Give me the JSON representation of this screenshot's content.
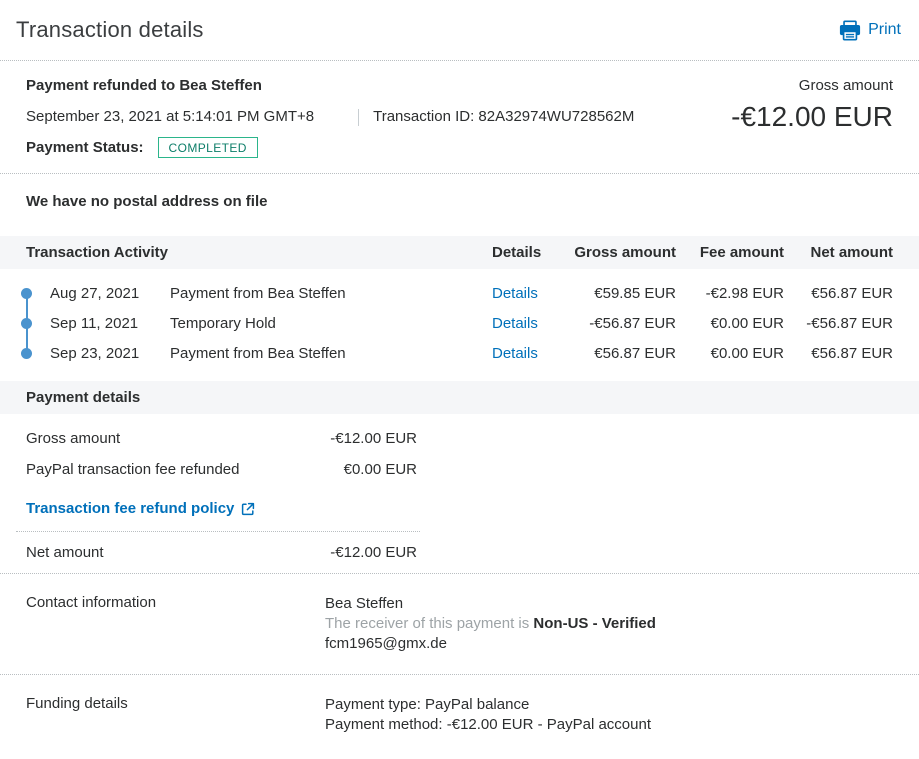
{
  "page": {
    "title": "Transaction details",
    "print_label": "Print"
  },
  "summary": {
    "heading": "Payment refunded to Bea Steffen",
    "date": "September 23, 2021 at 5:14:01 PM GMT+8",
    "transaction_id": "Transaction ID: 82A32974WU728562M",
    "payment_status_label": "Payment Status:",
    "payment_status": "COMPLETED",
    "gross_amount_label": "Gross amount",
    "gross_amount_value": "-€12.00 EUR"
  },
  "postal_note": "We have no postal address on file",
  "activity": {
    "title": "Transaction Activity",
    "columns": {
      "details": "Details",
      "gross": "Gross amount",
      "fee": "Fee amount",
      "net": "Net amount"
    },
    "rows": [
      {
        "date": "Aug 27, 2021",
        "description": "Payment from Bea Steffen",
        "details_label": "Details",
        "gross": "€59.85 EUR",
        "fee": "-€2.98 EUR",
        "net": "€56.87 EUR"
      },
      {
        "date": "Sep 11, 2021",
        "description": "Temporary Hold",
        "details_label": "Details",
        "gross": "-€56.87 EUR",
        "fee": "€0.00 EUR",
        "net": "-€56.87 EUR"
      },
      {
        "date": "Sep 23, 2021",
        "description": "Payment from Bea Steffen",
        "details_label": "Details",
        "gross": "€56.87 EUR",
        "fee": "€0.00 EUR",
        "net": "€56.87 EUR"
      }
    ]
  },
  "payment_details": {
    "title": "Payment details",
    "rows": [
      {
        "label": "Gross amount",
        "value": "-€12.00 EUR"
      },
      {
        "label": "PayPal transaction fee refunded",
        "value": "€0.00 EUR"
      }
    ],
    "policy_link_label": "Transaction fee refund policy",
    "net_label": "Net amount",
    "net_value": "-€12.00 EUR"
  },
  "contact": {
    "label": "Contact information",
    "name": "Bea Steffen",
    "receiver_prefix": "The receiver of this payment is ",
    "receiver_status": "Non-US - Verified",
    "email": "fcm1965@gmx.de"
  },
  "funding": {
    "label": "Funding details",
    "payment_type": "Payment type: PayPal balance",
    "payment_method": "Payment method: -€12.00 EUR - PayPal account"
  },
  "colors": {
    "link_blue": "#0070ba",
    "text_dark": "#2c2e2f",
    "status_border": "#2bb58b",
    "status_text": "#0c7d68",
    "timeline_blue": "#4a93ce",
    "section_bar_bg": "#f5f6f8"
  }
}
